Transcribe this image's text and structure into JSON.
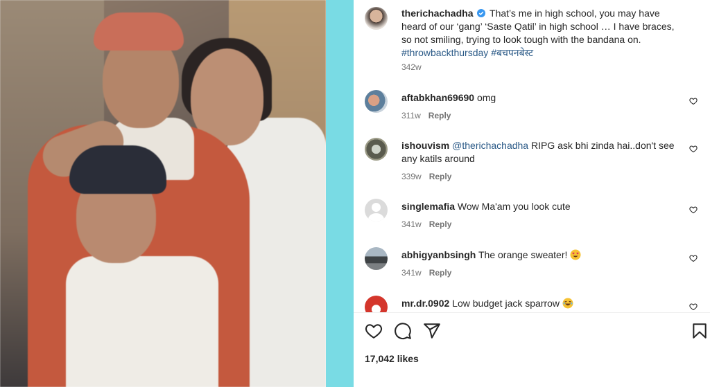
{
  "post": {
    "author": "therichachadha",
    "caption": "That’s me in high school, you may have heard of our ‘gang’ ‘Saste Qatil’ in high school … I have braces, so not smiling, trying to look tough with the bandana on.",
    "hashtags": [
      "#throwbackthursday",
      "#बचपनबेस्ट"
    ],
    "time": "342w",
    "likes": "17,042 likes"
  },
  "comments": [
    {
      "user": "aftabkhan69690",
      "mention": "",
      "text": "omg",
      "emoji": "",
      "time": "311w",
      "reply": "Reply"
    },
    {
      "user": "ishouvism",
      "mention": "@therichachadha",
      "text": "RIPG ask bhi zinda hai..don't see any katils around",
      "emoji": "",
      "time": "339w",
      "reply": "Reply"
    },
    {
      "user": "singlemafia",
      "mention": "",
      "text": "Wow Ma'am you look cute",
      "emoji": "",
      "time": "341w",
      "reply": "Reply"
    },
    {
      "user": "abhigyanbsingh",
      "mention": "",
      "text": "The orange sweater!",
      "emoji": "heart-eyes",
      "time": "341w",
      "reply": "Reply"
    },
    {
      "user": "mr.dr.0902",
      "mention": "",
      "text": "Low budget jack sparrow",
      "emoji": "laughing",
      "time": "",
      "reply": ""
    }
  ],
  "icons": {
    "like": "heart-icon",
    "comment": "comment-bubble-icon",
    "share": "paper-plane-icon",
    "save": "bookmark-icon",
    "verified": "verified-badge-icon"
  },
  "colors": {
    "hashtag": "#2b5a87",
    "verified": "#3897f0",
    "strip": "#79dbe4",
    "muted": "#737373"
  }
}
